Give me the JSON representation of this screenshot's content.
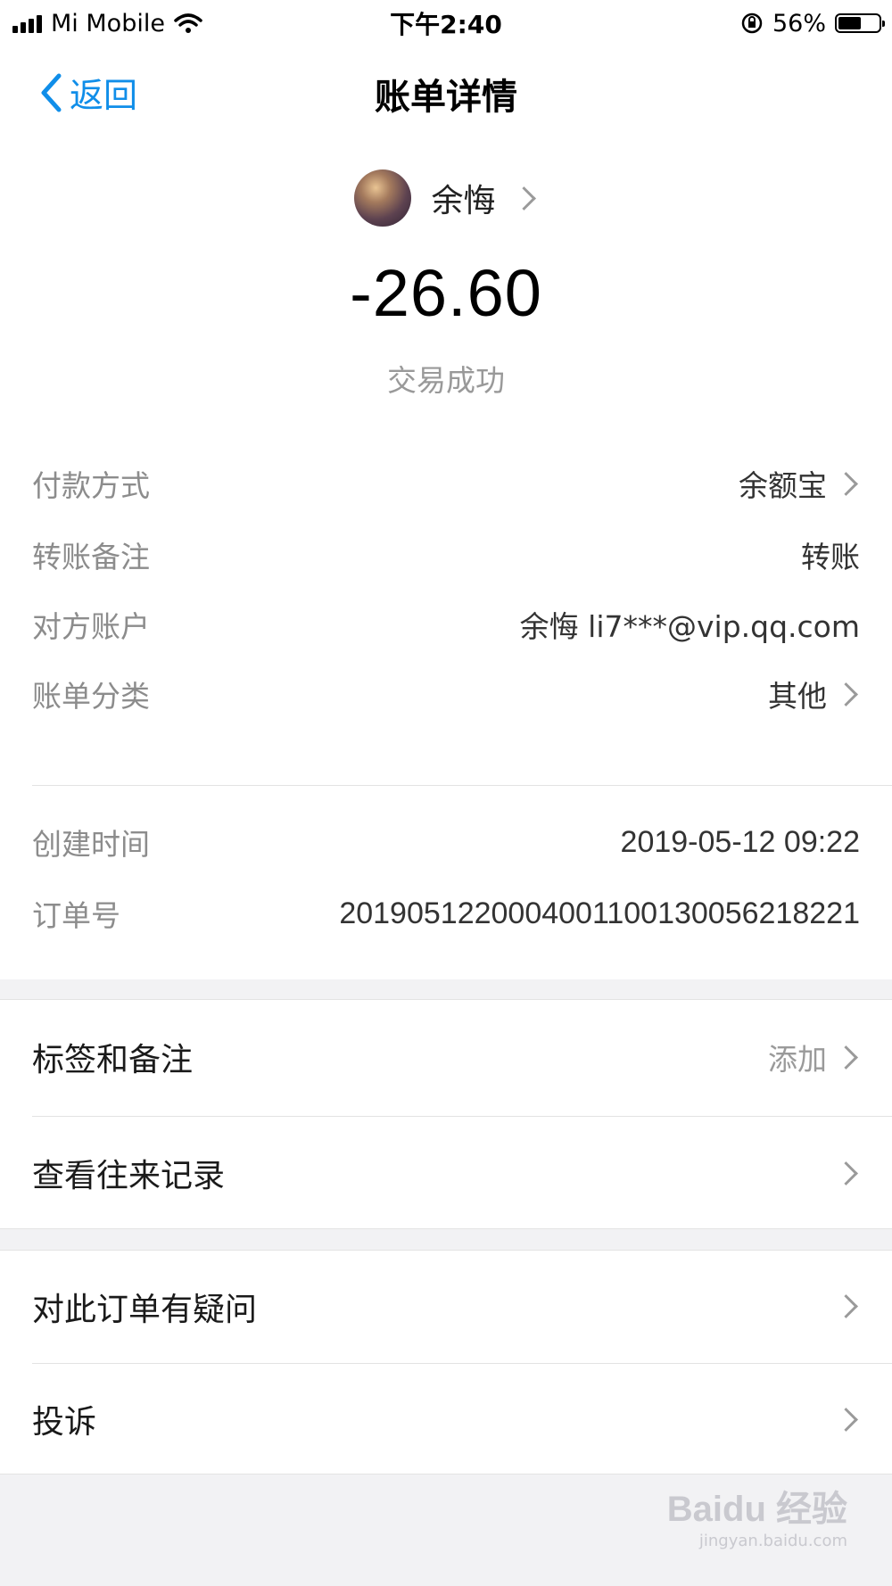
{
  "status_bar": {
    "carrier": "Mi Mobile",
    "time": "下午2:40",
    "battery": "56%",
    "battery_level": 0.56
  },
  "nav": {
    "back_label": "返回",
    "title": "账单详情"
  },
  "header": {
    "payee_name": "余悔",
    "amount": "-26.60",
    "status": "交易成功"
  },
  "details": [
    {
      "label": "付款方式",
      "value": "余额宝",
      "chevron": true
    },
    {
      "label": "转账备注",
      "value": "转账",
      "chevron": false
    },
    {
      "label": "对方账户",
      "value": "余悔 li7***@vip.qq.com",
      "chevron": false
    },
    {
      "label": "账单分类",
      "value": "其他",
      "chevron": true
    },
    {
      "label": "创建时间",
      "value": "2019-05-12 09:22",
      "chevron": false
    },
    {
      "label": "订单号",
      "value": "2019051220004001100130056218221",
      "chevron": false
    }
  ],
  "actions1": [
    {
      "label": "标签和备注",
      "value": "添加"
    },
    {
      "label": "查看往来记录",
      "value": ""
    }
  ],
  "actions2": [
    {
      "label": "对此订单有疑问"
    },
    {
      "label": "投诉"
    }
  ],
  "watermark": {
    "brand": "Baidu 经验",
    "url": "jingyan.baidu.com"
  },
  "colors": {
    "accent": "#108ee9",
    "label_gray": "#8c8c8c",
    "background": "#f2f2f4"
  },
  "icons": [
    "signal-icon",
    "wifi-icon",
    "rotation-lock-icon",
    "battery-icon",
    "back-chevron-icon",
    "chevron-right-icon",
    "avatar"
  ]
}
